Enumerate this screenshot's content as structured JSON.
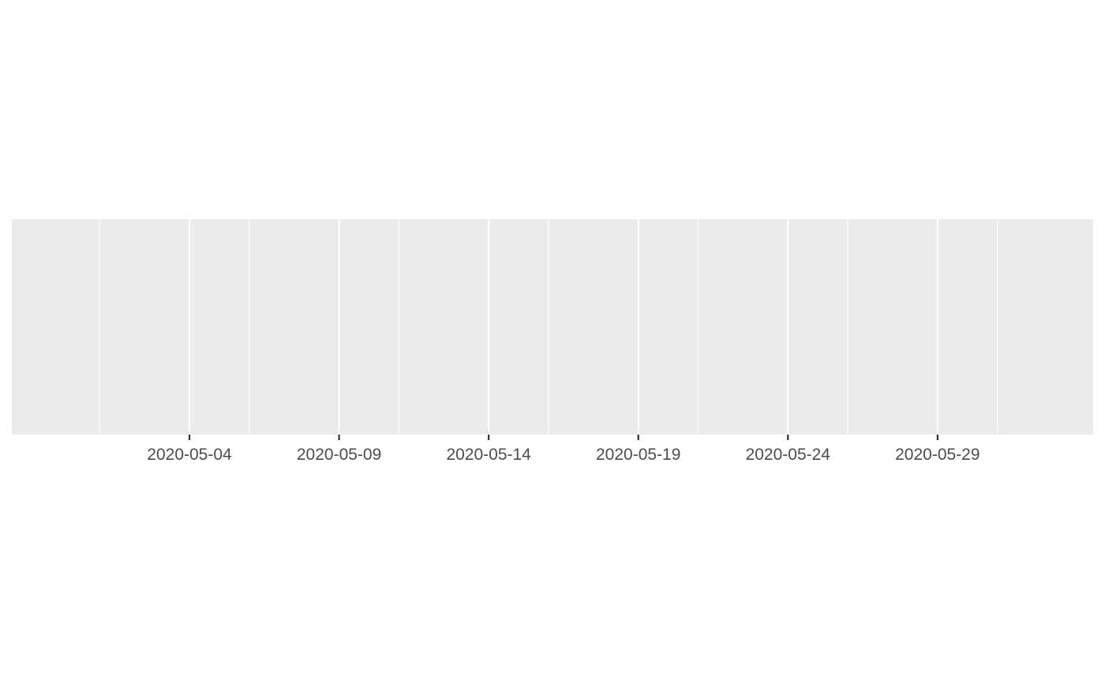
{
  "chart_data": {
    "type": "line",
    "title": "",
    "xlabel": "",
    "ylabel": "",
    "x_scale": "date",
    "xlim": [
      "2020-04-29",
      "2020-06-03"
    ],
    "x_major_ticks": [
      "2020-05-04",
      "2020-05-09",
      "2020-05-14",
      "2020-05-19",
      "2020-05-24",
      "2020-05-29"
    ],
    "x_minor_ticks": [
      "2020-05-01",
      "2020-05-06",
      "2020-05-11",
      "2020-05-16",
      "2020-05-21",
      "2020-05-26",
      "2020-05-31"
    ],
    "series": [],
    "y_axis_shown": false,
    "grid": true,
    "panel_color": "#EBEBEB",
    "grid_color": "#FFFFFF",
    "tick_label_color": "#4D4D4D",
    "tick_color": "#333333"
  }
}
